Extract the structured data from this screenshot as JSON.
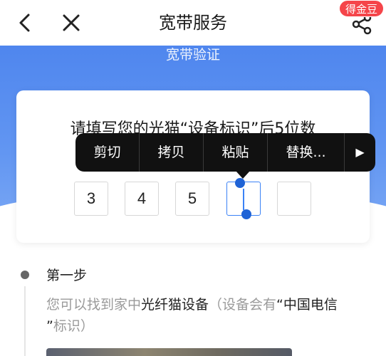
{
  "navbar": {
    "title": "宽带服务",
    "badge": "得金豆"
  },
  "hero": {
    "subtitle": "宽带验证"
  },
  "card": {
    "instruction": "请填写您的光猫“设备标识”后5位数",
    "digits": [
      "3",
      "4",
      "5",
      "",
      ""
    ]
  },
  "context_menu": {
    "items": [
      "剪切",
      "拷贝",
      "粘贴",
      "替换...",
      "▶"
    ]
  },
  "steps": [
    {
      "title": "第一步",
      "desc_prefix": "您可以找到家中",
      "desc_highlight1": "光纤猫设备",
      "desc_middle": "（设备会有",
      "desc_highlight2": "“中国电信",
      "desc_line2_highlight": "”",
      "desc_suffix": "标识）"
    }
  ],
  "colors": {
    "accent": "#3b82f6",
    "hero": "#5b8ef0",
    "badge": "#f5454a"
  }
}
